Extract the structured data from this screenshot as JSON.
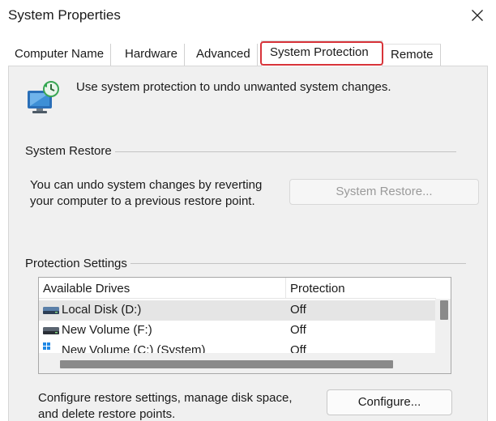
{
  "window": {
    "title": "System Properties"
  },
  "tabs": [
    {
      "label": "Computer Name"
    },
    {
      "label": "Hardware"
    },
    {
      "label": "Advanced"
    },
    {
      "label": "System Protection"
    },
    {
      "label": "Remote"
    }
  ],
  "intro": {
    "text": "Use system protection to undo unwanted system changes."
  },
  "system_restore": {
    "heading": "System Restore",
    "line1": "You can undo system changes by reverting",
    "line2": "your computer to a previous restore point.",
    "button_label": "System Restore..."
  },
  "protection": {
    "heading": "Protection Settings",
    "columns": [
      "Available Drives",
      "Protection"
    ],
    "rows": [
      {
        "drive": "Local Disk (D:)",
        "protection": "Off"
      },
      {
        "drive": "New Volume (F:)",
        "protection": "Off"
      },
      {
        "drive": "New Volume (C:) (System)",
        "protection": "Off"
      }
    ],
    "config_line1": "Configure restore settings, manage disk space,",
    "config_line2": "and delete restore points.",
    "configure_label": "Configure..."
  },
  "colors": {
    "highlight_border": "#d8343a",
    "panel_bg": "#f0f0f0",
    "selected_row": "#e5e5e5"
  }
}
